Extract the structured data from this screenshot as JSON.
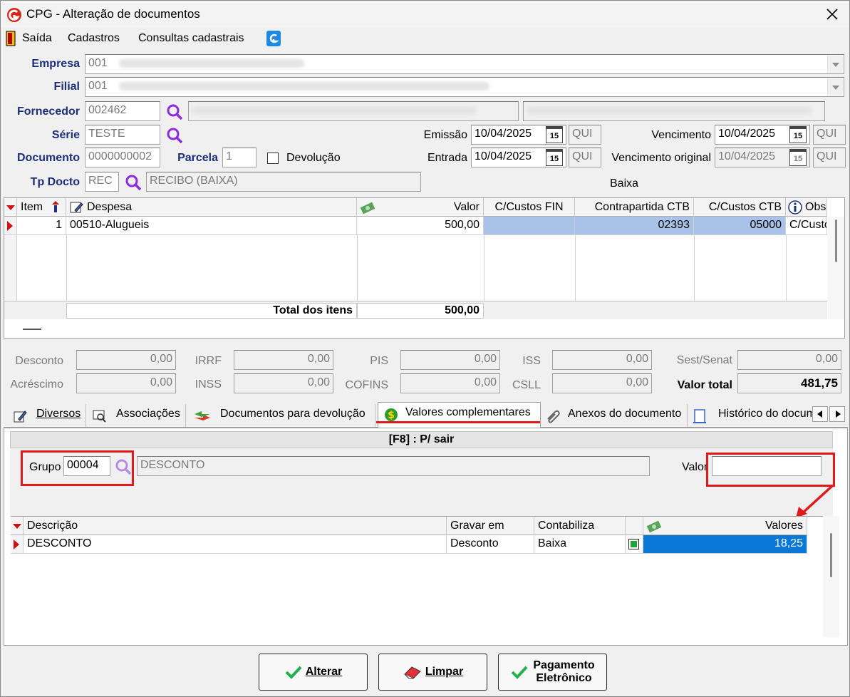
{
  "window": {
    "title": "CPG - Alteração de documentos"
  },
  "menu": {
    "items": [
      "Saída",
      "Cadastros",
      "Consultas cadastrais"
    ]
  },
  "form": {
    "empresa_label": "Empresa",
    "empresa_code": "001",
    "filial_label": "Filial",
    "filial_code": "001",
    "fornecedor_label": "Fornecedor",
    "fornecedor_code": "002462",
    "serie_label": "Série",
    "serie_value": "TESTE",
    "documento_label": "Documento",
    "documento_value": "0000000002",
    "parcela_label": "Parcela",
    "parcela_value": "1",
    "devolucao_label": "Devolução",
    "tpdocto_label": "Tp Docto",
    "tpdocto_code": "REC",
    "tpdocto_desc": "RECIBO (BAIXA)",
    "emissao_label": "Emissão",
    "emissao_date": "10/04/2025",
    "emissao_day": "QUI",
    "entrada_label": "Entrada",
    "entrada_date": "10/04/2025",
    "entrada_day": "QUI",
    "vencimento_label": "Vencimento",
    "vencimento_date": "10/04/2025",
    "vencimento_day": "QUI",
    "venc_original_label": "Vencimento original",
    "venc_original_date": "10/04/2025",
    "venc_original_day": "QUI",
    "baixa_label": "Baixa",
    "calendar_glyph": "15"
  },
  "items_grid": {
    "headers": {
      "item": "Item",
      "despesa": "Despesa",
      "valor": "Valor",
      "ccfin": "C/Custos FIN",
      "contrapartida": "Contrapartida CTB",
      "ccctb": "C/Custos CTB",
      "obs": "Obs"
    },
    "row": {
      "item": "1",
      "despesa": "00510-Alugueis",
      "valor": "500,00",
      "contrapartida": "02393",
      "ccctb": "05000",
      "obs": "C/Custo"
    },
    "total_label": "Total dos itens",
    "total_value": "500,00"
  },
  "totals": {
    "desconto_label": "Desconto",
    "desconto": "0,00",
    "acrescimo_label": "Acréscimo",
    "acrescimo": "0,00",
    "irrf_label": "IRRF",
    "irrf": "0,00",
    "inss_label": "INSS",
    "inss": "0,00",
    "pis_label": "PIS",
    "pis": "0,00",
    "cofins_label": "COFINS",
    "cofins": "0,00",
    "iss_label": "ISS",
    "iss": "0,00",
    "csll_label": "CSLL",
    "csll": "0,00",
    "sest_label": "Sest/Senat",
    "sest": "0,00",
    "valor_total_label": "Valor total",
    "valor_total": "481,75"
  },
  "tabs": [
    "Diversos",
    "Associações",
    "Documentos para devolução",
    "Valores complementares",
    "Anexos do documento",
    "Histórico do docum"
  ],
  "panel": {
    "banner": "[F8] : P/ sair",
    "grupo_label": "Grupo",
    "grupo_code": "00004",
    "grupo_desc": "DESCONTO",
    "valor_label": "Valor",
    "valor_value": "",
    "grid_headers": {
      "descricao": "Descrição",
      "gravar_em": "Gravar em",
      "contabiliza": "Contabiliza",
      "valores": "Valores"
    },
    "row": {
      "descricao": "DESCONTO",
      "gravar_em": "Desconto",
      "contabiliza": "Baixa",
      "valores": "18,25"
    }
  },
  "buttons": {
    "alterar": "Alterar",
    "limpar": "Limpar",
    "pagamento_line1": "Pagamento",
    "pagamento_line2": "Eletrônico"
  },
  "colors": {
    "accent_red": "#e01a1a",
    "selection_blue": "#0a78d7",
    "label_blue": "#1c2f7a"
  }
}
